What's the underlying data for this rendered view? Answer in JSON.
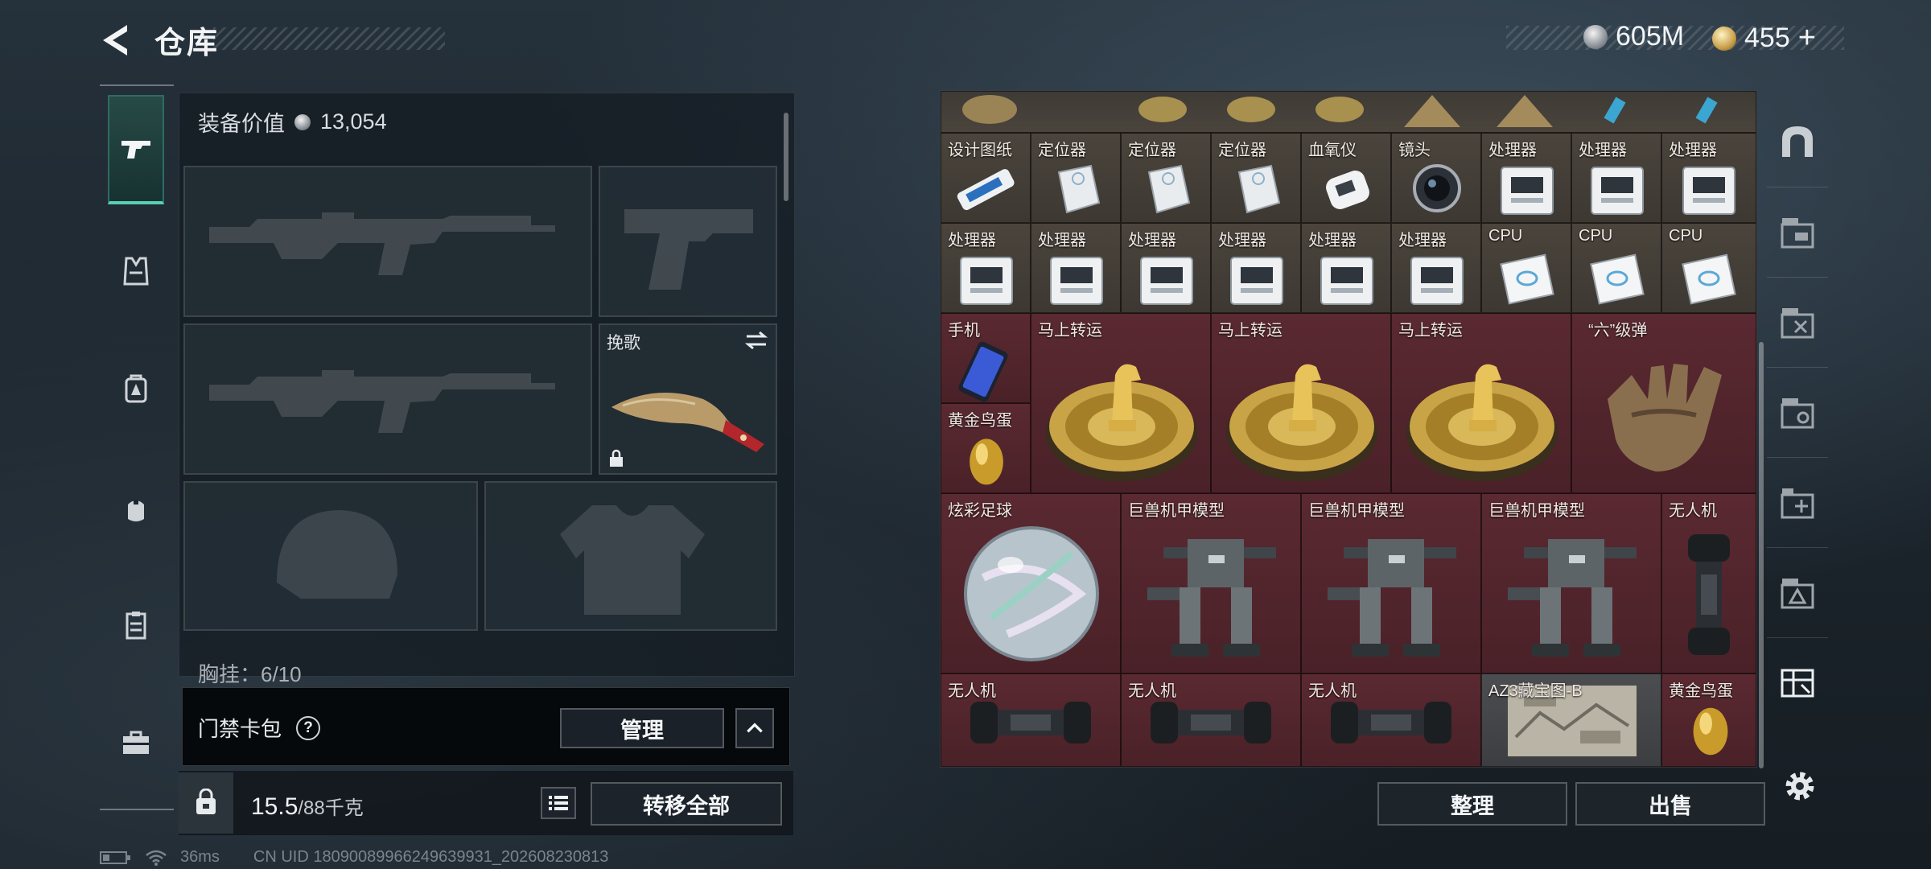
{
  "header": {
    "title": "仓库",
    "currency_silver": "605M",
    "currency_gold": "455",
    "currency_gold_plus": "+"
  },
  "loadout": {
    "equip_value_label": "装备价值",
    "equip_value": "13,054",
    "melee_slot_label": "挽歌",
    "chest_rig_label": "胸挂：6/10",
    "card_pack_label": "门禁卡包",
    "help_mark": "?",
    "manage_button": "管理",
    "weight_current": "15.5",
    "weight_max": "/88千克",
    "transfer_all_button": "转移全部"
  },
  "status_bar": {
    "ping": "36ms",
    "uid": "CN UID 18090089966249639931_202608230813"
  },
  "storage": {
    "sort_button": "整理",
    "sell_button": "出售",
    "items": [
      {
        "label": "设计图纸",
        "color": "tan",
        "icon": "blueprint-icon"
      },
      {
        "label": "定位器",
        "color": "tan",
        "icon": "locator-icon"
      },
      {
        "label": "定位器",
        "color": "tan",
        "icon": "locator-icon"
      },
      {
        "label": "定位器",
        "color": "tan",
        "icon": "locator-icon"
      },
      {
        "label": "血氧仪",
        "color": "tan",
        "icon": "oximeter-icon"
      },
      {
        "label": "镜头",
        "color": "tan",
        "icon": "lens-icon"
      },
      {
        "label": "处理器",
        "color": "tan",
        "icon": "processor-icon"
      },
      {
        "label": "处理器",
        "color": "tan",
        "icon": "processor-icon"
      },
      {
        "label": "处理器",
        "color": "tan",
        "icon": "processor-icon"
      },
      {
        "label": "处理器",
        "color": "tan",
        "icon": "processor-icon"
      },
      {
        "label": "处理器",
        "color": "tan",
        "icon": "processor-icon"
      },
      {
        "label": "处理器",
        "color": "tan",
        "icon": "processor-icon"
      },
      {
        "label": "处理器",
        "color": "tan",
        "icon": "processor-icon"
      },
      {
        "label": "处理器",
        "color": "tan",
        "icon": "processor-icon"
      },
      {
        "label": "处理器",
        "color": "tan",
        "icon": "processor-icon"
      },
      {
        "label": "CPU",
        "color": "tan",
        "icon": "cpu-icon"
      },
      {
        "label": "CPU",
        "color": "tan",
        "icon": "cpu-icon"
      },
      {
        "label": "CPU",
        "color": "tan",
        "icon": "cpu-icon"
      },
      {
        "label": "手机",
        "color": "red",
        "icon": "phone-icon"
      },
      {
        "label": "马上转运",
        "color": "red",
        "icon": "horse-medallion-icon"
      },
      {
        "label": "马上转运",
        "color": "red",
        "icon": "horse-medallion-icon"
      },
      {
        "label": "马上转运",
        "color": "red",
        "icon": "horse-medallion-icon"
      },
      {
        "label": "“六”级弹",
        "color": "red",
        "icon": "hand-sculpture-icon"
      },
      {
        "label": "黄金鸟蛋",
        "color": "red",
        "icon": "golden-egg-icon"
      },
      {
        "label": "炫彩足球",
        "color": "red",
        "icon": "iridescent-ball-icon"
      },
      {
        "label": "巨兽机甲模型",
        "color": "red",
        "icon": "mech-model-icon"
      },
      {
        "label": "巨兽机甲模型",
        "color": "red",
        "icon": "mech-model-icon"
      },
      {
        "label": "巨兽机甲模型",
        "color": "red",
        "icon": "mech-model-icon"
      },
      {
        "label": "无人机",
        "color": "red",
        "icon": "drone-icon"
      },
      {
        "label": "无人机",
        "color": "red",
        "icon": "drone-icon"
      },
      {
        "label": "无人机",
        "color": "red",
        "icon": "drone-icon"
      },
      {
        "label": "无人机",
        "color": "red",
        "icon": "drone-icon"
      },
      {
        "label": "AZ3藏宝图-B",
        "color": "gray",
        "icon": "treasure-map-icon"
      },
      {
        "label": "黄金鸟蛋",
        "color": "red",
        "icon": "golden-egg-icon"
      }
    ]
  },
  "colors": {
    "accent_teal": "#55d0b4",
    "cell_tan": "#4a443c",
    "cell_red": "#5a2931",
    "cell_gray": "#4b4d50"
  }
}
